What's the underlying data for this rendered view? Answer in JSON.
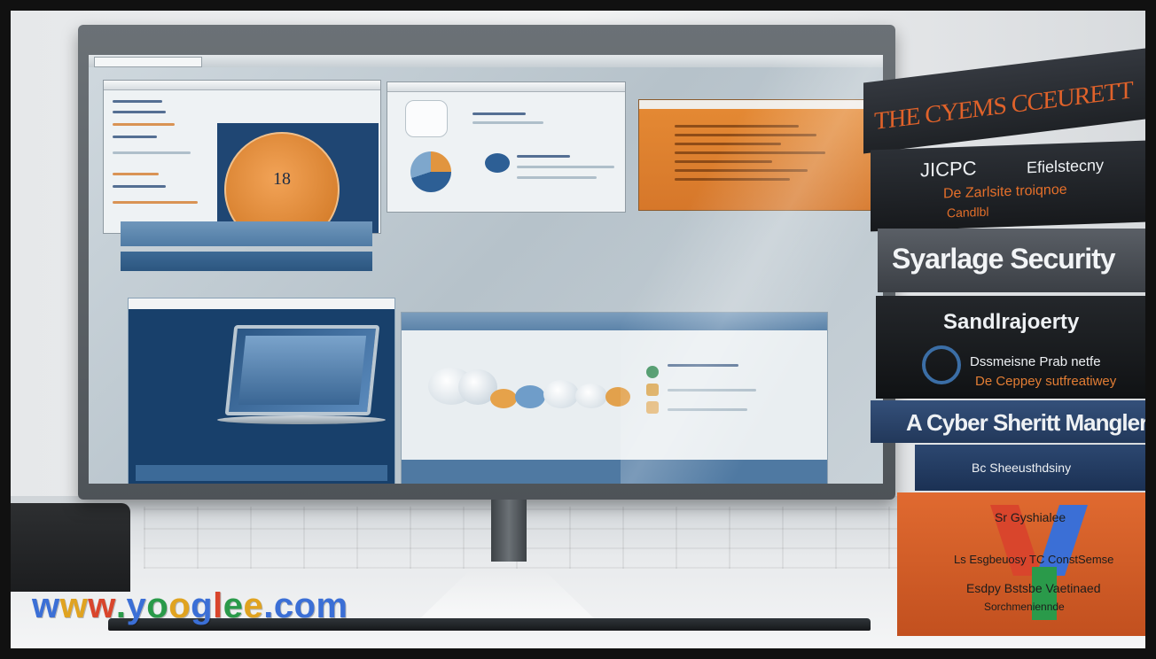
{
  "screen": {
    "left_panel_lines": [
      "",
      "",
      "",
      "",
      "",
      ""
    ],
    "hero_number": "18",
    "hero_subtitle": "",
    "band_1": "",
    "band_2": "",
    "mid_caption": "",
    "demo_title": "",
    "demo_subtitle": "",
    "diagram_label": ""
  },
  "books": [
    {
      "title": "THE CYEMS CCEURETT",
      "color": "#2a2d33",
      "accent": "#e0622a"
    },
    {
      "title": "JICPC",
      "subtitle": "Efielstecny",
      "extra": "De Zarlsite troiqnoe",
      "extra2": "Candlbl",
      "color": "#23262b"
    },
    {
      "title": "Syarlage Security",
      "color": "#4b4f55"
    },
    {
      "title": "Sandlrajoerty",
      "subtitle": "Dssmeisne Prab netfe",
      "extra": "De Ceppey sutfreatiwey",
      "color": "#202327"
    },
    {
      "title": "A Cyber Sheritt Mangler",
      "color": "#2b4166"
    },
    {
      "title": "Bc Sheeusthdsiny",
      "color": "#233a60"
    },
    {
      "title": "Sr Gyshialee",
      "subtitle": "Ls Esgbeuosy TC ConstSemse",
      "extra": "Esdpy Bstsbe Vaetinaed",
      "extra2": "Sorchmeniennde",
      "color": "#d9602a"
    }
  ],
  "watermark": {
    "parts": [
      {
        "text": "w",
        "color": "#3b6fd6"
      },
      {
        "text": "w",
        "color": "#e0a320"
      },
      {
        "text": "w",
        "color": "#d9452c"
      },
      {
        "text": ".",
        "color": "#2a9a4a"
      },
      {
        "text": "y",
        "color": "#3b6fd6"
      },
      {
        "text": "o",
        "color": "#2a9a4a"
      },
      {
        "text": "o",
        "color": "#e0a320"
      },
      {
        "text": "g",
        "color": "#3b6fd6"
      },
      {
        "text": "l",
        "color": "#d9452c"
      },
      {
        "text": "e",
        "color": "#2a9a4a"
      },
      {
        "text": "e",
        "color": "#e0a320"
      },
      {
        "text": ".",
        "color": "#3b6fd6"
      },
      {
        "text": "c",
        "color": "#3b6fd6"
      },
      {
        "text": "o",
        "color": "#3b6fd6"
      },
      {
        "text": "m",
        "color": "#3b6fd6"
      }
    ]
  }
}
